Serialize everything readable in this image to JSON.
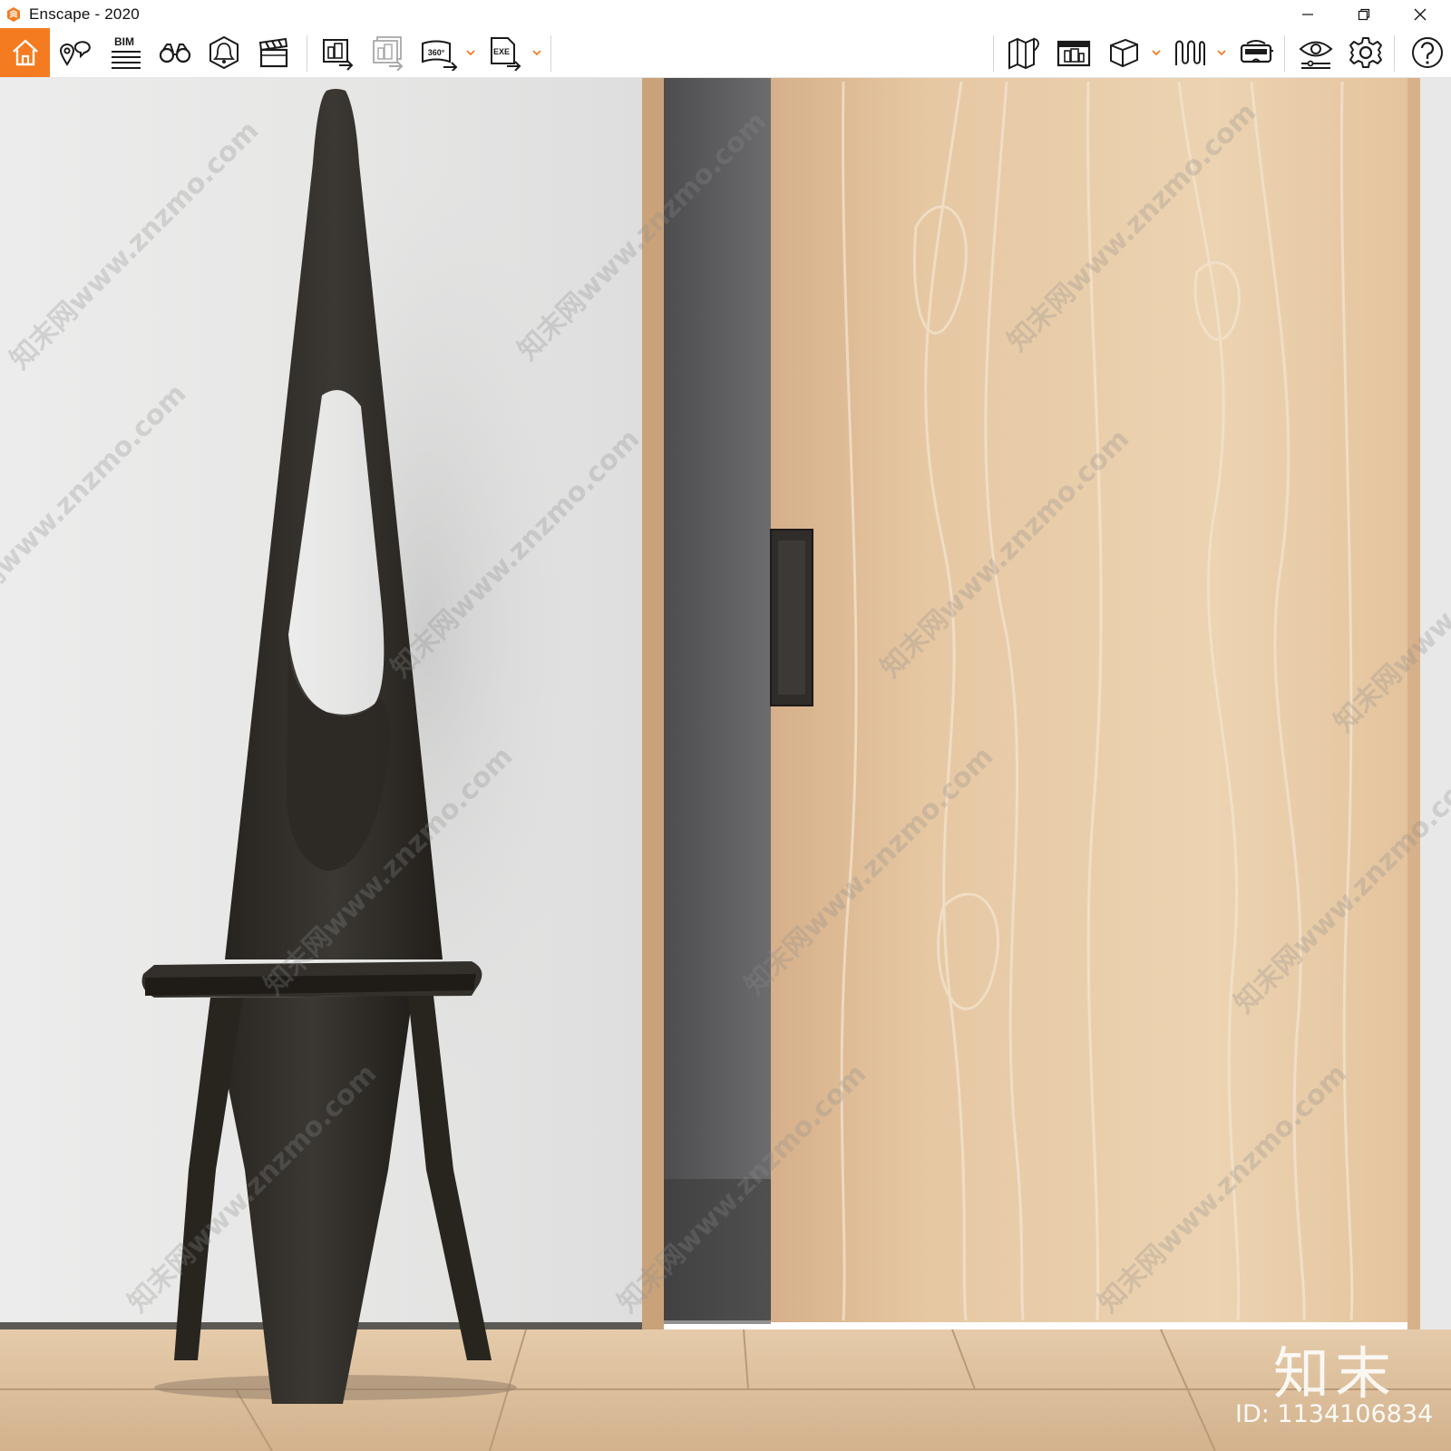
{
  "window": {
    "title": "Enscape - 2020",
    "controls": [
      "minimize",
      "restore",
      "close"
    ]
  },
  "toolbar": {
    "accent_color": "#f47b20",
    "left_tools": [
      {
        "name": "home-icon",
        "active": true
      },
      {
        "name": "location-pin-icon"
      },
      {
        "name": "bim-icon",
        "label": "BIM"
      },
      {
        "name": "binoculars-icon"
      },
      {
        "name": "light-view-icon"
      },
      {
        "name": "clapperboard-icon"
      },
      {
        "name": "render-screenshot-icon"
      },
      {
        "name": "batch-render-icon"
      },
      {
        "name": "panorama-360-icon",
        "label": "360°",
        "dropdown": true
      },
      {
        "name": "export-exe-icon",
        "label": "EXE",
        "dropdown": true
      }
    ],
    "right_tools": [
      {
        "name": "map-icon"
      },
      {
        "name": "asset-library-icon"
      },
      {
        "name": "cube-icon",
        "dropdown": true
      },
      {
        "name": "material-icon",
        "dropdown": true
      },
      {
        "name": "vr-headset-icon"
      },
      {
        "name": "visual-settings-icon"
      },
      {
        "name": "settings-gear-icon"
      },
      {
        "name": "help-icon"
      }
    ]
  },
  "viewport": {
    "scene": "chair-and-sliding-wood-door-render",
    "watermark_text": "知末网www.znzmo.com",
    "brand_mark": "知末",
    "image_id": "ID: 1134106834"
  }
}
